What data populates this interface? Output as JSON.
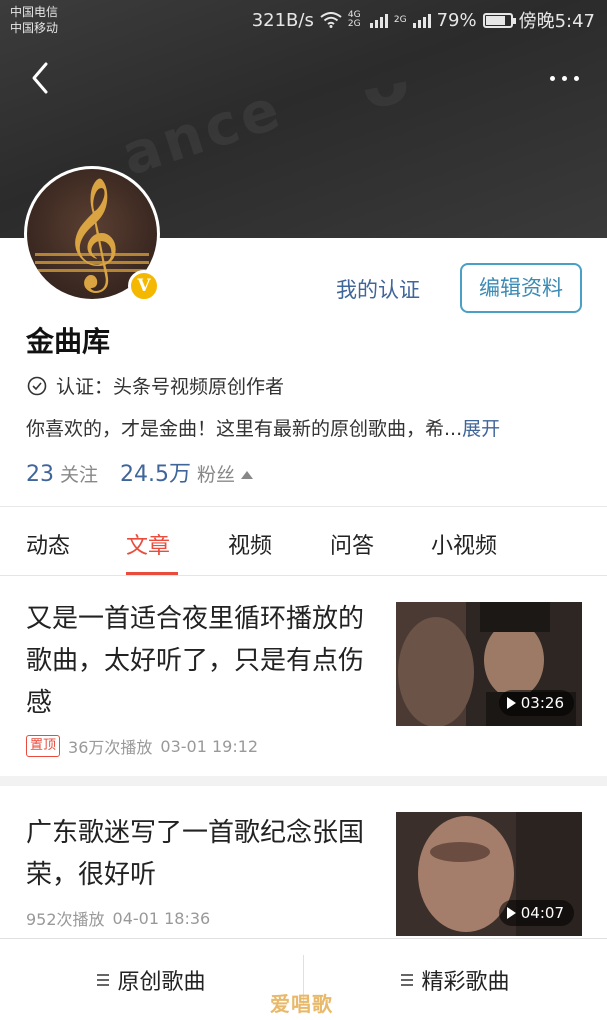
{
  "status_bar": {
    "carrier_1": "中国电信",
    "carrier_2": "中国移动",
    "speed": "321B/s",
    "net_1": "4G 2G",
    "net_2": "2G",
    "battery": "79%",
    "battery_level": 0.79,
    "time": "傍晚5:47"
  },
  "header": {
    "back_icon": "back-arrow-icon",
    "more_icon": "more-dots-icon"
  },
  "profile": {
    "verify_link": "我的认证",
    "edit_button": "编辑资料",
    "name": "金曲库",
    "verified_badge": "V",
    "cert_text": "认证：头条号视频原创作者",
    "desc": "你喜欢的，才是金曲！这里有最新的原创歌曲，希...",
    "desc_more": "展开",
    "following_count": "23",
    "following_label": "关注",
    "fans_count": "24.5万",
    "fans_label": "粉丝"
  },
  "tabs": [
    {
      "label": "动态",
      "active": false
    },
    {
      "label": "文章",
      "active": true
    },
    {
      "label": "视频",
      "active": false
    },
    {
      "label": "问答",
      "active": false
    },
    {
      "label": "小视频",
      "active": false
    }
  ],
  "articles": [
    {
      "title": "又是一首适合夜里循环播放的歌曲，太好听了，只是有点伤感",
      "pinned": "置顶",
      "plays": "36万次播放",
      "date": "03-01 19:12",
      "duration": "03:26"
    },
    {
      "title": "广东歌迷写了一首歌纪念张国荣，很好听",
      "plays": "952次播放",
      "date": "04-01 18:36",
      "duration": "04:07"
    }
  ],
  "bottom_bar": {
    "item_1": "原创歌曲",
    "item_2": "精彩歌曲"
  },
  "watermark": "爱唱歌",
  "colors": {
    "accent_red": "#e94c3d",
    "link_blue": "#406599",
    "badge_gold": "#f5b800",
    "edit_border": "#4a9fc4"
  }
}
